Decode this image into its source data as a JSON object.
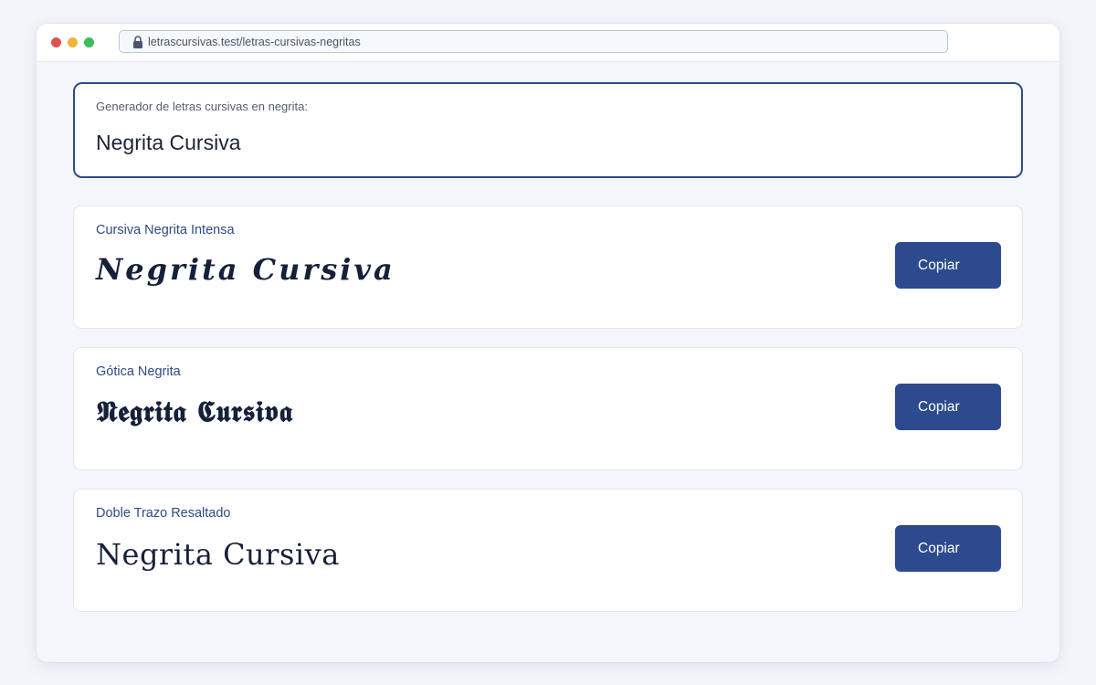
{
  "browser": {
    "url": "letrascursivas.test/letras-cursivas-negritas",
    "lock_icon": "lock-icon",
    "window_controls": [
      "close",
      "minimize",
      "maximize"
    ],
    "control_colors": {
      "close": "#e0524f",
      "minimize": "#f1b43a",
      "maximize": "#3dbb5b"
    }
  },
  "generator": {
    "label": "Generador de letras cursivas en negrita:",
    "value": "Negrita Cursiva"
  },
  "results": [
    {
      "title": "Cursiva Negrita Intensa",
      "text": "𝑵𝒆𝒈𝒓𝒊𝒕𝒂 𝑪𝒖𝒓𝒔𝒊𝒗𝒂",
      "button": "Copiar"
    },
    {
      "title": "Gótica Negrita",
      "text": "𝕹𝖊𝖌𝖗𝖎𝖙𝖆 𝕮𝖚𝖗𝖘𝖎𝖛𝖆",
      "button": "Copiar"
    },
    {
      "title": "Doble Trazo Resaltado",
      "text": "Negrita Cursiva",
      "button": "Copiar"
    }
  ],
  "colors": {
    "accent": "#2d4a8e",
    "input_border": "#2d4a8a",
    "title_text": "#2f4a86",
    "background": "#f3f5fa"
  }
}
